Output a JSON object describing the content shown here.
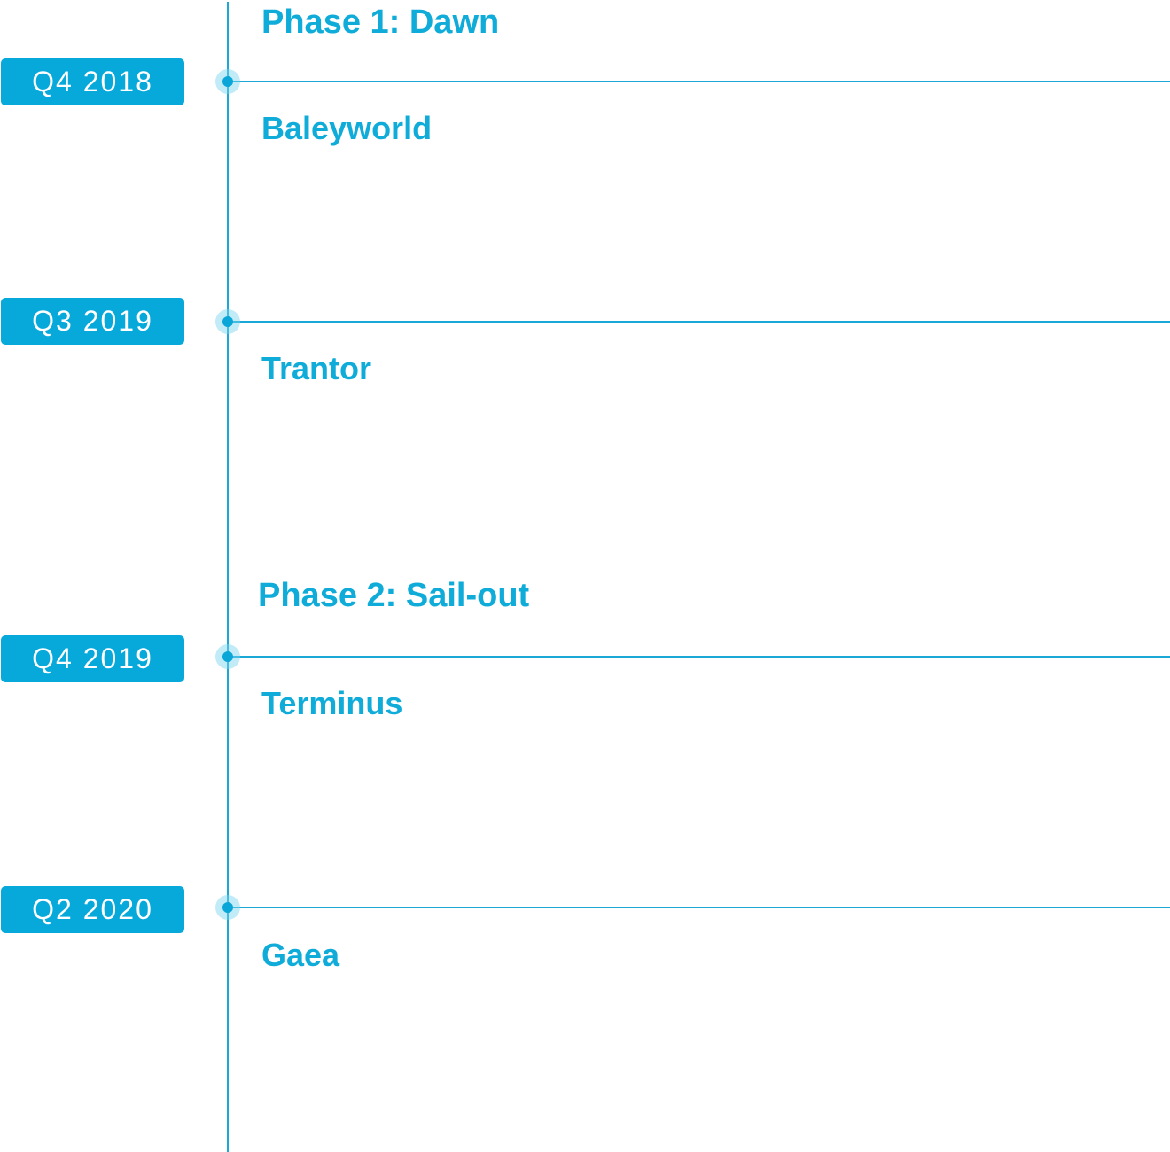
{
  "colors": {
    "accent": "#07a9db",
    "line": "#1aa9d6",
    "node_glow": "#78d2f0",
    "background": "#ffffff"
  },
  "phases": [
    {
      "label": "Phase 1: Dawn"
    },
    {
      "label": "Phase 2: Sail-out"
    }
  ],
  "milestones": [
    {
      "date": "Q4 2018",
      "name": "Baleyworld"
    },
    {
      "date": "Q3 2019",
      "name": "Trantor"
    },
    {
      "date": "Q4 2019",
      "name": "Terminus"
    },
    {
      "date": "Q2 2020",
      "name": "Gaea"
    }
  ]
}
